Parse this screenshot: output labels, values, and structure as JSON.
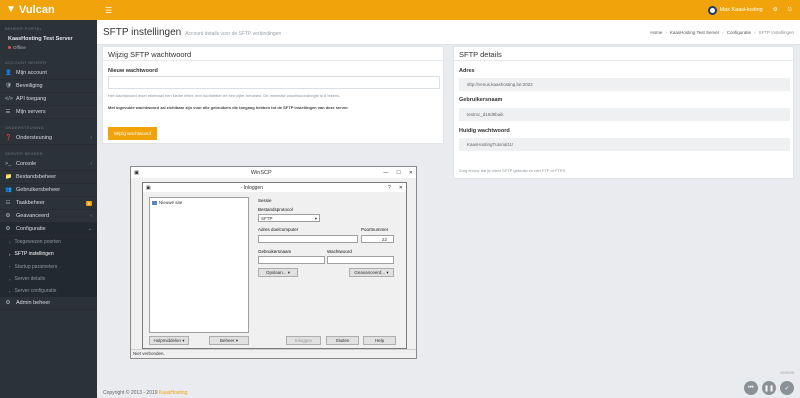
{
  "app": {
    "brand": "Vulcan"
  },
  "topbar": {
    "user_name": "Max KaasHosting"
  },
  "sidebar": {
    "section_server": "BEHEER PORTAL",
    "server_name": "KaasHosting Test Server",
    "server_status": "Offline",
    "section_account": "ACCOUNT BEHEER",
    "account_items": [
      {
        "icon": "👤",
        "label": "Mijn account"
      },
      {
        "icon": "🛡",
        "label": "Beveiliging"
      },
      {
        "icon": "</>",
        "label": "API toegang"
      },
      {
        "icon": "☰",
        "label": "Mijn servers"
      }
    ],
    "section_support": "ONDERSTEUNING",
    "support_items": [
      {
        "icon": "❓",
        "label": "Ondersteuning"
      }
    ],
    "section_server_beheer": "SERVER BEHEER",
    "server_items": [
      {
        "icon": ">_",
        "label": "Console"
      },
      {
        "icon": "📁",
        "label": "Bestandsbeheer"
      },
      {
        "icon": "👥",
        "label": "Gebruikersbeheer"
      },
      {
        "icon": "☷",
        "label": "Taakbeheer",
        "badge": "8"
      },
      {
        "icon": "⚙",
        "label": "Geavanceerd"
      },
      {
        "icon": "⚙",
        "label": "Configuratie"
      }
    ],
    "sub_items": [
      {
        "label": "Toegewezen poorten"
      },
      {
        "label": "SFTP instellingen"
      },
      {
        "label": "Startup parameters"
      },
      {
        "label": "Server details"
      },
      {
        "label": "Server configuratie"
      }
    ],
    "admin": {
      "icon": "⚙",
      "label": "Admin beheer"
    }
  },
  "header": {
    "title": "SFTP instellingen",
    "subtitle": "Account details voor de SFTP verbindingen",
    "breadcrumb": [
      "Home",
      "KaasHosting Test Server",
      "Configuratie",
      "SFTP Instellingen"
    ]
  },
  "password_panel": {
    "title": "Wijzig SFTP wachtwoord",
    "field_label": "Nieuw wachtwoord",
    "help": "Het wachtwoord moet minimaal een kleine letter, een hoofdletter en een cijfer bevatten. De minimale wachtwoordlengte is 8 tekens.",
    "warning": "Met ingevulde wachtwoord zal zichtbaar zijn voor alle gebruikers die toegang hebben tot de SFTP instellingen van deze server.",
    "button": "Wijzig wachtwoord"
  },
  "details_panel": {
    "title": "SFTP details",
    "address_label": "Adres",
    "address": "sftp://venus.kaashosting.be:2022",
    "username_label": "Gebruikersnaam",
    "username": "testmc_d19d9baik",
    "password_label": "Huidig wachtwoord",
    "password": "KaasHostingTutorial11!",
    "note": "Zorg ervoor dat je client SFTP gebruikt en niet FTP of FTPS."
  },
  "winscp": {
    "outer_title": "WinSCP",
    "inner_title": "- Inloggen",
    "tree_item": "Nieuwe site",
    "section": "Sessie",
    "protocol_label": "Bestandsprotocol",
    "protocol": "SFTP",
    "host_label": "Adres doelcomputer",
    "host": "",
    "port_label": "Poortnummer",
    "port": "22",
    "user_label": "Gebruikersnaam",
    "user": "",
    "pass_label": "Wachtwoord",
    "pass": "",
    "save_btn": "Opslaan...",
    "advanced_btn": "Geavanceerd...",
    "tools_btn": "Hulpmiddelen",
    "manage_btn": "Beheer",
    "login_btn": "Inloggen",
    "close_btn": "Sluiten",
    "help_btn": "Help",
    "status": "Niet verbonden."
  },
  "footer": {
    "copyright": "Copyright © 2013 - 2019 ",
    "brand": "KaasHosting."
  },
  "media": {
    "time": "00:00:05"
  }
}
